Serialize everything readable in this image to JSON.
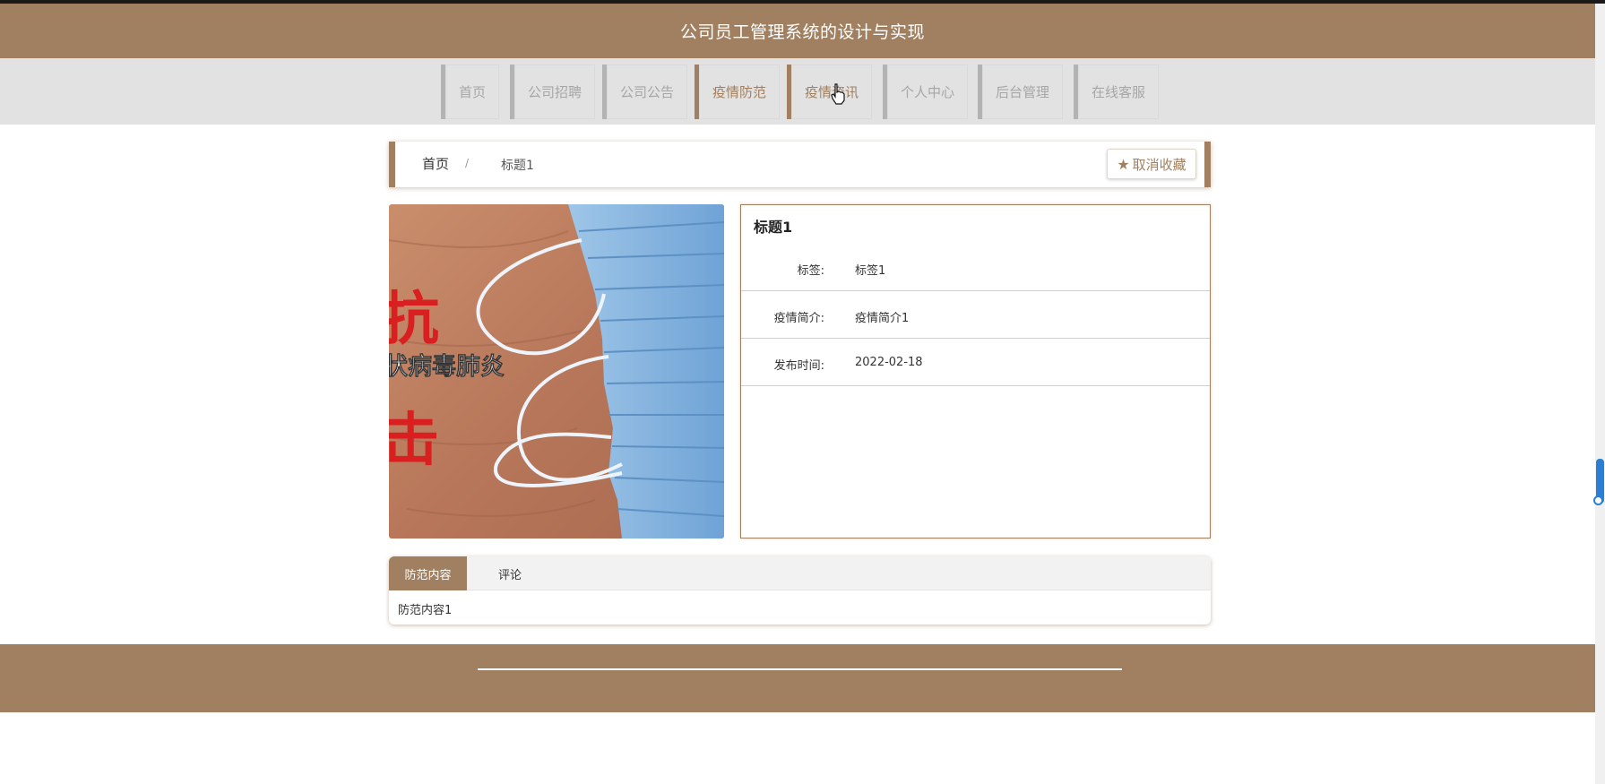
{
  "header": {
    "title": "公司员工管理系统的设计与实现"
  },
  "nav": {
    "items": [
      {
        "label": "首页",
        "active": false
      },
      {
        "label": "公司招聘",
        "active": false
      },
      {
        "label": "公司公告",
        "active": false
      },
      {
        "label": "疫情防范",
        "active": true
      },
      {
        "label": "疫情资讯",
        "active": true
      },
      {
        "label": "个人中心",
        "active": false
      },
      {
        "label": "后台管理",
        "active": false
      },
      {
        "label": "在线客服",
        "active": false
      }
    ]
  },
  "breadcrumb": {
    "home": "首页",
    "separator": "/",
    "current": "标题1"
  },
  "favorite_button": {
    "icon": "star-icon",
    "label": "取消收藏"
  },
  "image": {
    "overlay_text_1": "抗",
    "overlay_text_2": "状病毒肺炎",
    "overlay_text_3": "击"
  },
  "detail": {
    "title": "标题1",
    "rows": [
      {
        "label": "标签:",
        "value": "标签1"
      },
      {
        "label": "疫情简介:",
        "value": "疫情简介1"
      },
      {
        "label": "发布时间:",
        "value": "2022-02-18"
      }
    ]
  },
  "tabs": {
    "items": [
      {
        "label": "防范内容",
        "active": true
      },
      {
        "label": "评论",
        "active": false
      }
    ],
    "content": "防范内容1"
  },
  "colors": {
    "brand": "#a08060",
    "nav_bg": "#e2e2e2",
    "nav_text": "#a6a6a6"
  }
}
